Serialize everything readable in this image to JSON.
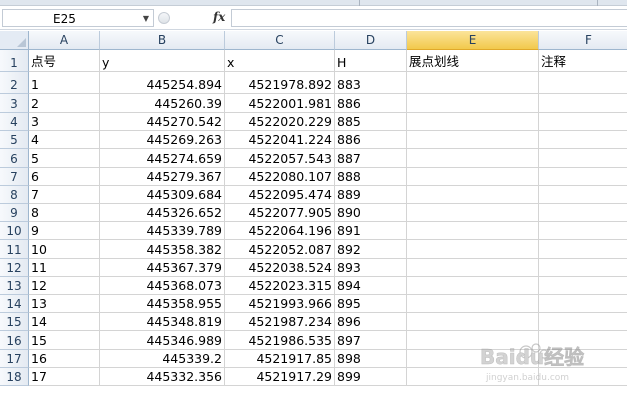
{
  "name_box": {
    "value": "E25"
  },
  "formula_bar": {
    "fx_label": "fx",
    "value": ""
  },
  "columns": [
    "A",
    "B",
    "C",
    "D",
    "E",
    "F"
  ],
  "selected_column": "E",
  "row_numbers": [
    "1",
    "2",
    "3",
    "4",
    "5",
    "6",
    "7",
    "8",
    "9",
    "10",
    "11",
    "12",
    "13",
    "14",
    "15",
    "16",
    "17",
    "18"
  ],
  "header_row": [
    "点号",
    "y",
    "x",
    "H",
    "展点划线",
    "注释"
  ],
  "data_rows": [
    [
      "1",
      "445254.894",
      "4521978.892",
      "883"
    ],
    [
      "2",
      "445260.39",
      "4522001.981",
      "886"
    ],
    [
      "3",
      "445270.542",
      "4522020.229",
      "885"
    ],
    [
      "4",
      "445269.263",
      "4522041.224",
      "886"
    ],
    [
      "5",
      "445274.659",
      "4522057.543",
      "887"
    ],
    [
      "6",
      "445279.367",
      "4522080.107",
      "888"
    ],
    [
      "7",
      "445309.684",
      "4522095.474",
      "889"
    ],
    [
      "8",
      "445326.652",
      "4522077.905",
      "890"
    ],
    [
      "9",
      "445339.789",
      "4522064.196",
      "891"
    ],
    [
      "10",
      "445358.382",
      "4522052.087",
      "892"
    ],
    [
      "11",
      "445367.379",
      "4522038.524",
      "893"
    ],
    [
      "12",
      "445368.073",
      "4522023.315",
      "894"
    ],
    [
      "13",
      "445358.955",
      "4521993.966",
      "895"
    ],
    [
      "14",
      "445348.819",
      "4521987.234",
      "896"
    ],
    [
      "15",
      "445346.989",
      "4521986.535",
      "897"
    ],
    [
      "16",
      "445339.2",
      "4521917.85",
      "898"
    ],
    [
      "17",
      "445332.356",
      "4521917.29",
      "899"
    ]
  ],
  "watermark": {
    "text": "Baidu经验",
    "sub": "jingyan.baidu.com"
  },
  "colors": {
    "grid_line": "#d4d4d4",
    "header_bg": "#e4eaf2",
    "selected_header": "#f2c94c",
    "header_text": "#27415f"
  }
}
